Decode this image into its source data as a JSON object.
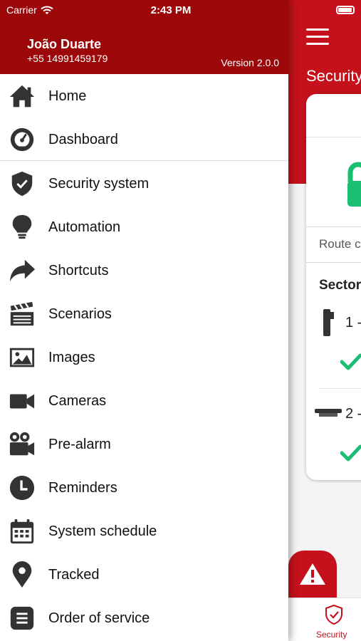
{
  "status_bar": {
    "carrier": "Carrier",
    "time": "2:43 PM"
  },
  "user": {
    "name": "João Duarte",
    "phone": "+55 14991459179"
  },
  "app_version": "Version 2.0.0",
  "menu": {
    "items": [
      {
        "label": "Home",
        "icon": "home-icon"
      },
      {
        "label": "Dashboard",
        "icon": "dashboard-icon"
      },
      {
        "label": "Security system",
        "icon": "shield-icon"
      },
      {
        "label": "Automation",
        "icon": "lightbulb-icon"
      },
      {
        "label": "Shortcuts",
        "icon": "share-arrow-icon"
      },
      {
        "label": "Scenarios",
        "icon": "clapperboard-icon"
      },
      {
        "label": "Images",
        "icon": "image-icon"
      },
      {
        "label": "Cameras",
        "icon": "video-camera-icon"
      },
      {
        "label": "Pre-alarm",
        "icon": "film-camera-icon"
      },
      {
        "label": "Reminders",
        "icon": "clock-icon"
      },
      {
        "label": "System schedule",
        "icon": "calendar-icon"
      },
      {
        "label": "Tracked",
        "icon": "location-pin-icon"
      },
      {
        "label": "Order of service",
        "icon": "document-icon"
      }
    ]
  },
  "background_screen": {
    "title": "Security",
    "route_label": "Route c",
    "sectors_title": "Sector",
    "sectors": [
      {
        "label": "1 -",
        "icon": "door-sensor-icon",
        "status_icon": "check-icon"
      },
      {
        "label": "2 -",
        "icon": "motion-sensor-icon",
        "status_icon": "check-icon"
      }
    ],
    "tab_bar": {
      "security_label": "Security"
    }
  },
  "colors": {
    "brand_red": "#c4111b",
    "header_dark_red": "#9c0809",
    "success_green": "#1bbf72"
  }
}
